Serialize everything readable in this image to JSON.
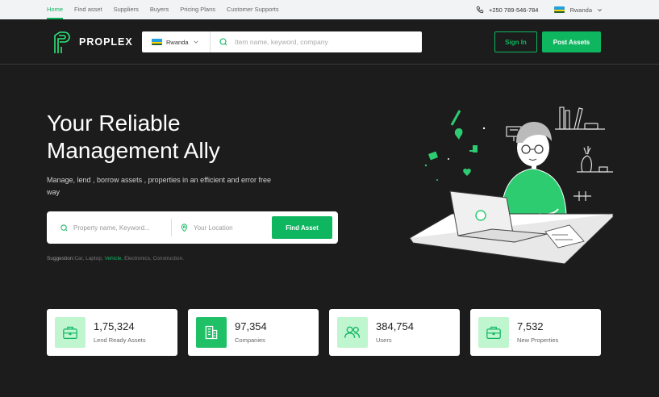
{
  "topbar": {
    "nav": [
      {
        "label": "Home",
        "active": true
      },
      {
        "label": "Find asset",
        "active": false
      },
      {
        "label": "Suppliers",
        "active": false
      },
      {
        "label": "Buyers",
        "active": false
      },
      {
        "label": "Pricing Plans",
        "active": false
      },
      {
        "label": "Customer Supports",
        "active": false
      }
    ],
    "phone": "+250 789-546-784",
    "country": "Rwanda"
  },
  "header": {
    "brand": "PROPLEX",
    "search_country": "Rwanda",
    "search_placeholder": "Item name, keyword, company",
    "signin_label": "Sign In",
    "post_label": "Post Assets"
  },
  "hero": {
    "title_line1": "Your Reliable",
    "title_line2": "Management Ally",
    "subtitle": "Manage, lend , borrow assets , properties in  an efficient and error free way",
    "property_placeholder": "Property name, Keyword...",
    "location_placeholder": "Your Location",
    "find_label": "Find Asset",
    "suggestion_label": "Suggestion:",
    "suggestions": [
      "Car,",
      "Laptop,",
      "Vehicle,",
      "Electronics,",
      "Construction."
    ],
    "highlighted_suggestion": "Vehicle,"
  },
  "stats": [
    {
      "value": "1,75,324",
      "label": "Lend Ready Assets",
      "icon": "briefcase-icon"
    },
    {
      "value": "97,354",
      "label": "Companies",
      "icon": "building-icon"
    },
    {
      "value": "384,754",
      "label": "Users",
      "icon": "users-icon"
    },
    {
      "value": "7,532",
      "label": "New Properties",
      "icon": "briefcase-icon"
    }
  ],
  "colors": {
    "accent": "#0fb660",
    "background": "#1c1c1c",
    "icon_bg": "#bff5cf"
  }
}
